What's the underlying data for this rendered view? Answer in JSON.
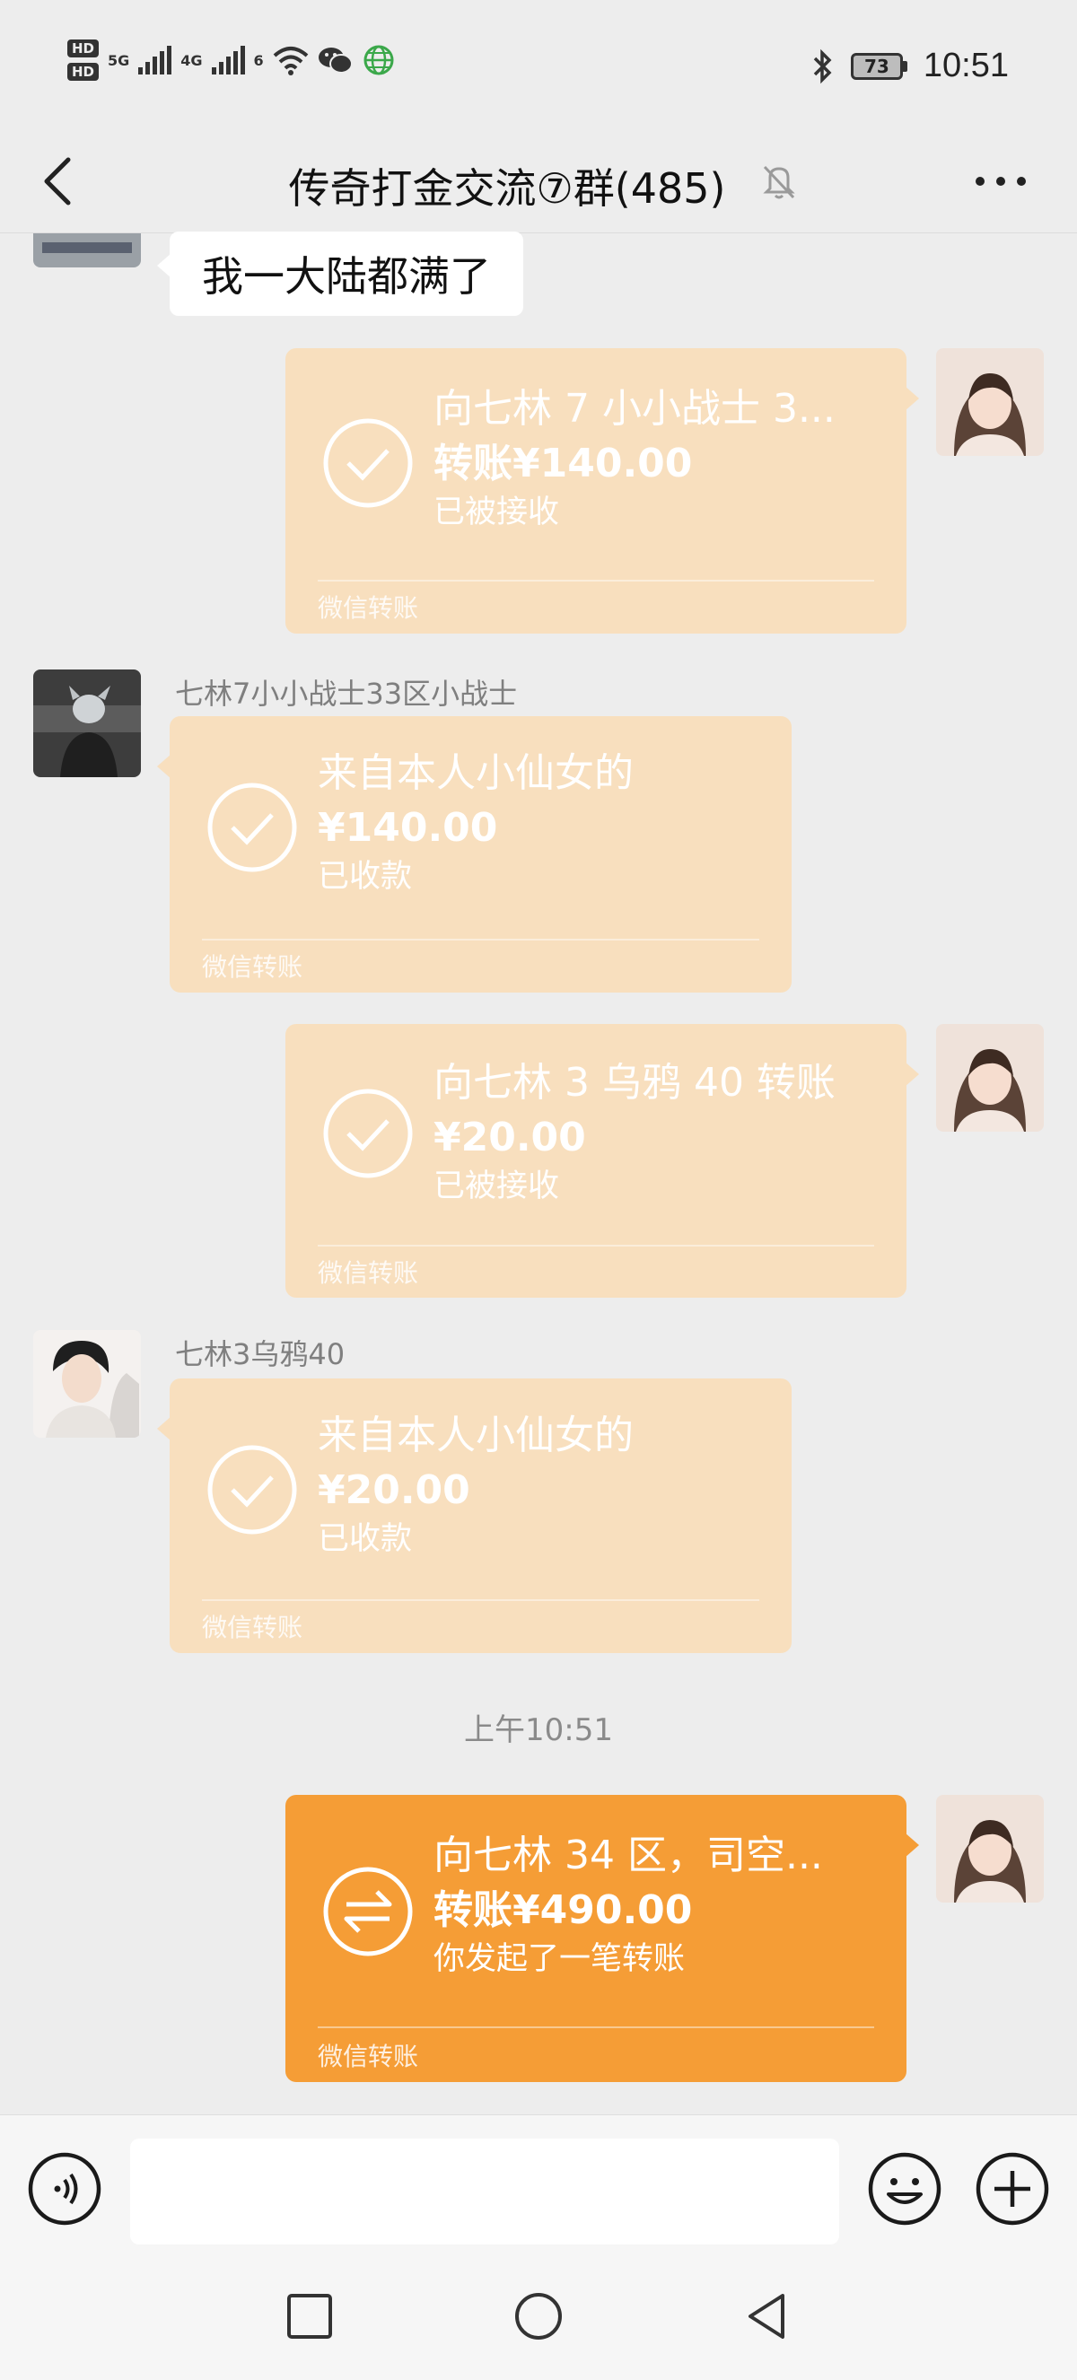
{
  "status_bar": {
    "time": "10:51",
    "battery": "73",
    "hd1": "HD",
    "hd2": "HD",
    "net1": "5G",
    "net2": "4G",
    "net3": "6"
  },
  "header": {
    "title": "传奇打金交流⑦群(485)"
  },
  "messages": [
    {
      "type": "text",
      "direction": "incoming",
      "text": "我一大陆都满了"
    },
    {
      "type": "transfer",
      "direction": "outgoing",
      "line1": "向七林 7 小小战士 3...",
      "line2": "转账¥140.00",
      "line3": "已被接收",
      "footer": "微信转账"
    },
    {
      "type": "transfer",
      "direction": "incoming",
      "sender": "七林7小小战士33区小战士",
      "line1": "来自本人小仙女的",
      "line2": "¥140.00",
      "line3": "已收款",
      "footer": "微信转账"
    },
    {
      "type": "transfer",
      "direction": "outgoing",
      "line1": "向七林 3 乌鸦 40 转账",
      "line2": "¥20.00",
      "line3": "已被接收",
      "footer": "微信转账"
    },
    {
      "type": "transfer",
      "direction": "incoming",
      "sender": "七林3乌鸦40",
      "line1": "来自本人小仙女的",
      "line2": "¥20.00",
      "line3": "已收款",
      "footer": "微信转账"
    },
    {
      "type": "timestamp",
      "text": "上午10:51"
    },
    {
      "type": "transfer",
      "direction": "outgoing",
      "status": "pending",
      "line1": "向七林 34 区，司空...",
      "line2": "转账¥490.00",
      "line3": "你发起了一笔转账",
      "footer": "微信转账"
    }
  ],
  "colors": {
    "background": "#ededed",
    "transfer_done": "#f8dfbe",
    "transfer_pending": "#f59d36"
  },
  "icons": {
    "back": "chevron-left-icon",
    "mute": "bell-off-icon",
    "more": "more-dots-icon",
    "voice": "voice-icon",
    "emoji": "emoji-icon",
    "plus": "plus-icon"
  }
}
